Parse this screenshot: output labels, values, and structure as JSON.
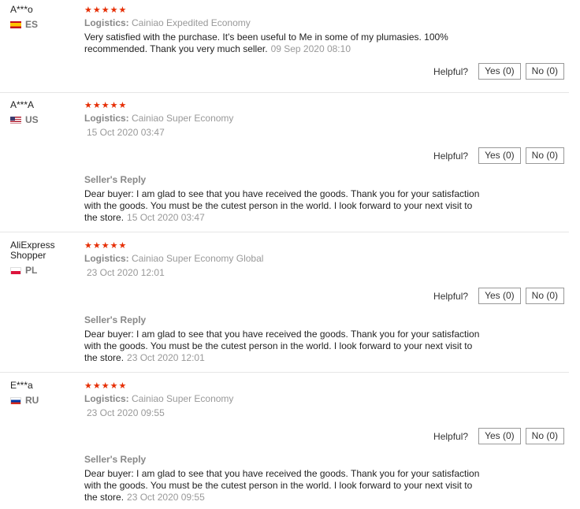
{
  "reviews": [
    {
      "buyer": "A***o",
      "country": "ES",
      "stars": "★★★★★",
      "logistics_label": "Logistics:",
      "logistics": "Cainiao Expedited Economy",
      "feedback": "Very satisfied with the purchase. It's been useful to Me in some of my plumasies. 100% recommended. Thank you very much seller.",
      "date": "09 Sep 2020 08:10",
      "helpful_label": "Helpful?",
      "yes": "Yes (0)",
      "no": "No (0)"
    },
    {
      "buyer": "A***A",
      "country": "US",
      "stars": "★★★★★",
      "logistics_label": "Logistics:",
      "logistics": "Cainiao Super Economy",
      "date": "15 Oct 2020 03:47",
      "helpful_label": "Helpful?",
      "yes": "Yes (0)",
      "no": "No (0)",
      "reply_title": "Seller's Reply",
      "reply": "Dear buyer: I am glad to see that you have received the goods. Thank you for your satisfaction with the goods. You must be the cutest person in the world. I look forward to your next visit to the store.",
      "reply_date": "15 Oct 2020 03:47"
    },
    {
      "buyer": "AliExpress Shopper",
      "country": "PL",
      "stars": "★★★★★",
      "logistics_label": "Logistics:",
      "logistics": "Cainiao Super Economy Global",
      "date": "23 Oct 2020 12:01",
      "helpful_label": "Helpful?",
      "yes": "Yes (0)",
      "no": "No (0)",
      "reply_title": "Seller's Reply",
      "reply": "Dear buyer: I am glad to see that you have received the goods. Thank you for your satisfaction with the goods. You must be the cutest person in the world. I look forward to your next visit to the store.",
      "reply_date": "23 Oct 2020 12:01"
    },
    {
      "buyer": "E***a",
      "country": "RU",
      "stars": "★★★★★",
      "logistics_label": "Logistics:",
      "logistics": "Cainiao Super Economy",
      "date": "23 Oct 2020 09:55",
      "helpful_label": "Helpful?",
      "yes": "Yes (0)",
      "no": "No (0)",
      "reply_title": "Seller's Reply",
      "reply": "Dear buyer: I am glad to see that you have received the goods. Thank you for your satisfaction with the goods. You must be the cutest person in the world. I look forward to your next visit to the store.",
      "reply_date": "23 Oct 2020 09:55"
    }
  ],
  "colors": {
    "star": "#e62e04",
    "muted": "#999999",
    "divider": "#e6e6e6"
  }
}
